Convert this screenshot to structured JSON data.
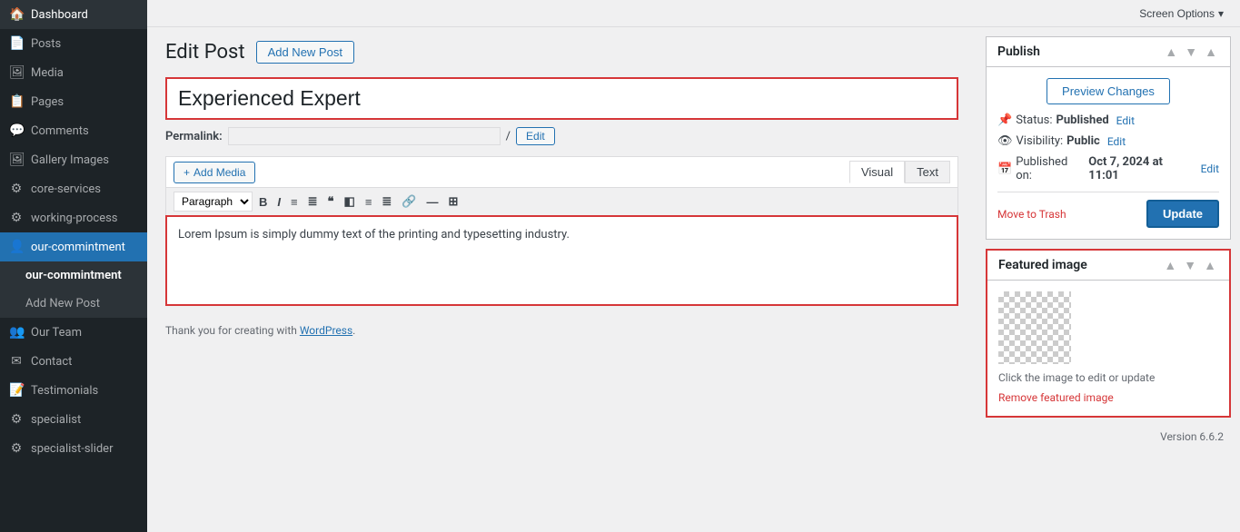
{
  "sidebar": {
    "items": [
      {
        "id": "dashboard",
        "label": "Dashboard",
        "icon": "🏠"
      },
      {
        "id": "posts",
        "label": "Posts",
        "icon": "📄"
      },
      {
        "id": "media",
        "label": "Media",
        "icon": "🖼"
      },
      {
        "id": "pages",
        "label": "Pages",
        "icon": "📋"
      },
      {
        "id": "comments",
        "label": "Comments",
        "icon": "💬"
      },
      {
        "id": "gallery-images",
        "label": "Gallery Images",
        "icon": "🖼"
      },
      {
        "id": "core-services",
        "label": "core-services",
        "icon": "⚙"
      },
      {
        "id": "working-process",
        "label": "working-process",
        "icon": "⚙"
      },
      {
        "id": "our-commintment",
        "label": "our-commintment",
        "icon": "👤"
      }
    ],
    "submenu": [
      {
        "id": "our-commintment-sub",
        "label": "our-commintment"
      },
      {
        "id": "add-new-post-sub",
        "label": "Add New Post"
      }
    ],
    "below_items": [
      {
        "id": "our-team",
        "label": "Our Team",
        "icon": "👥"
      },
      {
        "id": "contact",
        "label": "Contact",
        "icon": "✉"
      },
      {
        "id": "testimonials",
        "label": "Testimonials",
        "icon": "📝"
      },
      {
        "id": "specialist",
        "label": "specialist",
        "icon": "⚙"
      },
      {
        "id": "specialist-slider",
        "label": "specialist-slider",
        "icon": "⚙"
      }
    ]
  },
  "topbar": {
    "screen_options": "Screen Options"
  },
  "page": {
    "title": "Edit Post",
    "add_new_label": "Add New Post"
  },
  "editor": {
    "post_title": "Experienced Expert",
    "permalink_label": "Permalink:",
    "permalink_url": "",
    "permalink_edit": "Edit",
    "add_media": "Add Media",
    "visual_tab": "Visual",
    "text_tab": "Text",
    "paragraph_select": "Paragraph",
    "body_text": "Lorem Ipsum is simply dummy text of the printing and typesetting industry.",
    "footer_text": "Thank you for creating with",
    "footer_link": "WordPress",
    "footer_link_url": "#"
  },
  "publish": {
    "title": "Publish",
    "preview_changes": "Preview Changes",
    "status_label": "Status:",
    "status_value": "Published",
    "status_edit": "Edit",
    "visibility_label": "Visibility:",
    "visibility_value": "Public",
    "visibility_edit": "Edit",
    "published_label": "Published on:",
    "published_value": "Oct 7, 2024 at 11:01",
    "published_edit": "Edit",
    "move_to_trash": "Move to Trash",
    "update": "Update"
  },
  "featured_image": {
    "title": "Featured image",
    "caption": "Click the image to edit or update",
    "remove_link": "Remove featured image"
  },
  "footer": {
    "version": "Version 6.6.2"
  },
  "icons": {
    "chevron_up": "▲",
    "chevron_down": "▼",
    "chevron_down_small": "▾",
    "status_icon": "📌",
    "visibility_icon": "👁",
    "calendar_icon": "📅",
    "add_media_icon": "+"
  }
}
